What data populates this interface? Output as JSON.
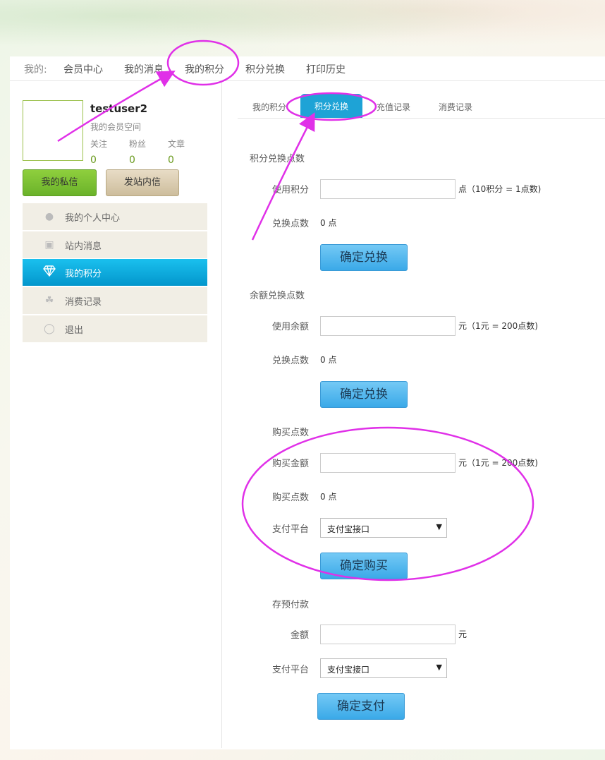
{
  "top_nav": {
    "lead": "我的:",
    "items": [
      "会员中心",
      "我的消息",
      "我的积分",
      "积分兑换",
      "打印历史"
    ]
  },
  "profile": {
    "username": "testuser2",
    "space": "我的会员空间",
    "stats": [
      {
        "label": "关注",
        "value": "0"
      },
      {
        "label": "粉丝",
        "value": "0"
      },
      {
        "label": "文章",
        "value": "0"
      }
    ],
    "btn_private_msg": "我的私信",
    "btn_send_msg": "发站内信"
  },
  "sidebar": {
    "items": [
      {
        "label": "我的个人中心",
        "icon": "user-icon"
      },
      {
        "label": "站内消息",
        "icon": "message-icon"
      },
      {
        "label": "我的积分",
        "icon": "diamond-icon",
        "active": true
      },
      {
        "label": "消费记录",
        "icon": "cart-icon"
      },
      {
        "label": "退出",
        "icon": "power-icon"
      }
    ]
  },
  "tabs": {
    "items": [
      "我的积分",
      "积分兑换",
      "充值记录",
      "消费记录"
    ],
    "active_index": 1
  },
  "form": {
    "points_exchange": {
      "title": "积分兑换点数",
      "use_label": "使用积分",
      "use_hint": "点（10积分 = 1点数)",
      "result_label": "兑换点数",
      "result_value": "0 点",
      "submit": "确定兑换"
    },
    "balance_exchange": {
      "title": "余额兑换点数",
      "use_label": "使用余额",
      "use_hint": "元（1元 = 200点数)",
      "result_label": "兑换点数",
      "result_value": "0 点",
      "submit": "确定兑换"
    },
    "purchase": {
      "title": "购买点数",
      "amount_label": "购买金额",
      "amount_hint": "元（1元 = 200点数)",
      "points_label": "购买点数",
      "points_value": "0 点",
      "platform_label": "支付平台",
      "platform_value": "支付宝接口",
      "submit": "确定购买"
    },
    "prepay": {
      "title": "存预付款",
      "amount_label": "金额",
      "amount_unit": "元",
      "platform_label": "支付平台",
      "platform_value": "支付宝接口",
      "submit": "确定支付"
    }
  },
  "colors": {
    "accent_blue": "#1ea3d6",
    "annotation_magenta": "#e030e8",
    "green": "#6ab22a"
  }
}
